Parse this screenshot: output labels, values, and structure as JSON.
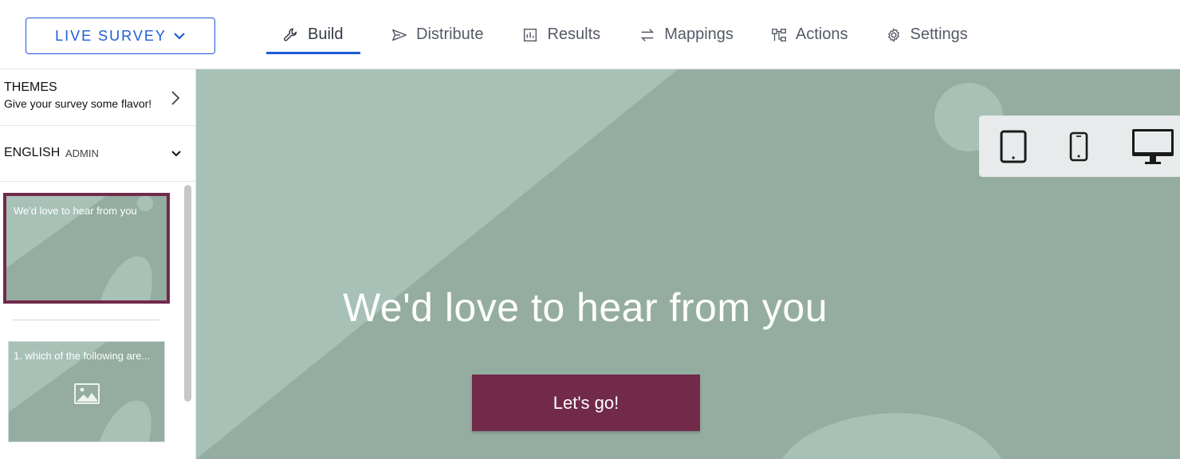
{
  "header": {
    "status_button": "LIVE SURVEY",
    "tabs": [
      {
        "label": "Build",
        "icon": "wrench-icon",
        "active": true
      },
      {
        "label": "Distribute",
        "icon": "send-icon"
      },
      {
        "label": "Results",
        "icon": "bar-chart-icon"
      },
      {
        "label": "Mappings",
        "icon": "arrows-exchange-icon"
      },
      {
        "label": "Actions",
        "icon": "workflow-icon"
      },
      {
        "label": "Settings",
        "icon": "gear-icon"
      }
    ],
    "accent_color": "#1c5bd6"
  },
  "sidebar": {
    "themes": {
      "title": "THEMES",
      "subtitle": "Give your survey some flavor!"
    },
    "language": {
      "title": "ENGLISH",
      "badge": "ADMIN"
    },
    "pages": [
      {
        "text": "We'd love to hear from you",
        "selected": true
      },
      {
        "text": "1. which of the following are...",
        "has_image": true
      }
    ]
  },
  "canvas": {
    "title": "We'd love to hear from you",
    "button_label": "Let's go!",
    "background_color": "#94ada0",
    "button_color": "#722a4b",
    "devices": [
      "tablet-icon",
      "phone-icon",
      "desktop-icon"
    ]
  }
}
